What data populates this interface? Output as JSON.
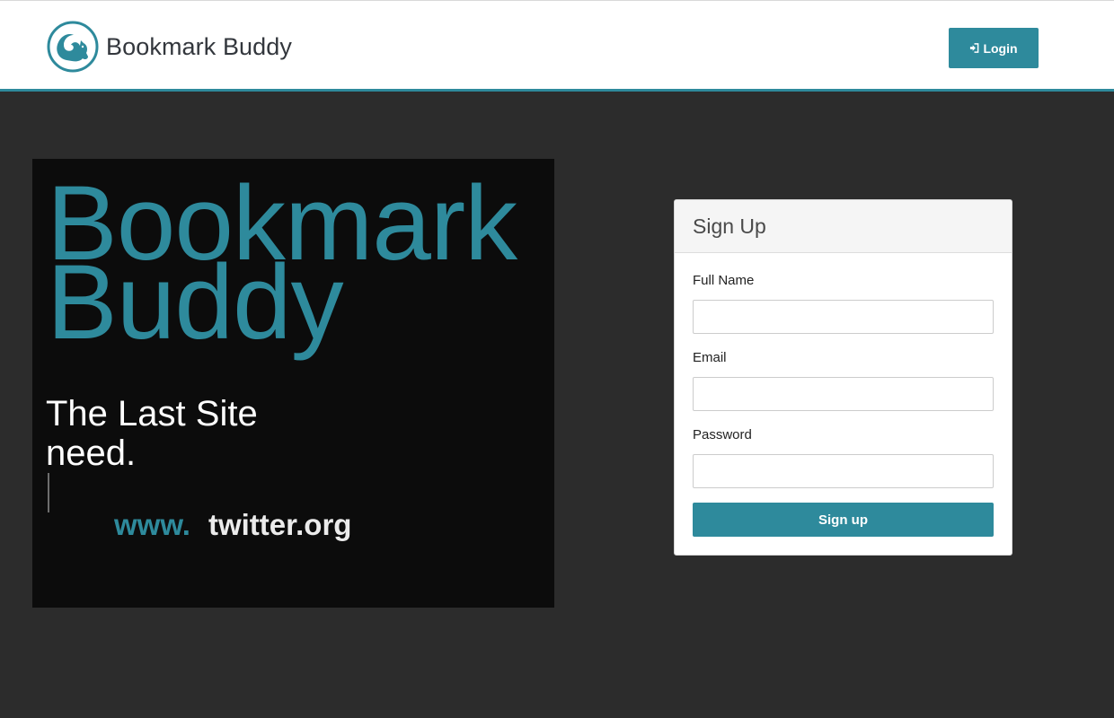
{
  "navbar": {
    "brand_name": "Bookmark Buddy",
    "logo_icon": "squirrel-icon",
    "login_icon": "sign-in-icon",
    "login_label": "Login"
  },
  "promo": {
    "title_line1": "Bookmark",
    "title_line2": "Buddy",
    "tagline_line1": "The Last Site",
    "tagline_line2": "need.",
    "url_prefix": "www.",
    "url_domain": "twitter.org"
  },
  "signup": {
    "title": "Sign Up",
    "full_name_label": "Full Name",
    "full_name_value": "",
    "email_label": "Email",
    "email_value": "",
    "password_label": "Password",
    "password_value": "",
    "submit_label": "Sign up"
  },
  "colors": {
    "accent": "#2e8a9c",
    "page_background": "#2c2c2c",
    "promo_background": "#0c0c0c",
    "navbar_background": "#ffffff"
  }
}
